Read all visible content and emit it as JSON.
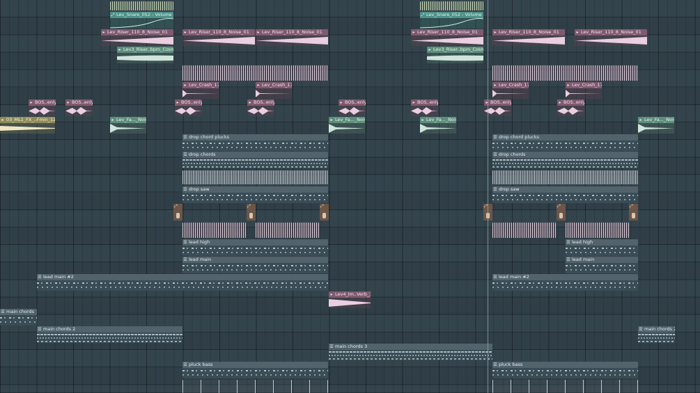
{
  "app": {
    "view": "playlist"
  },
  "colors": {
    "audio": "#7f5a6f",
    "pattern": "#52636c",
    "automation": "#4e9187",
    "riser": "#5c8e7b",
    "fx": "#8f8a5a"
  },
  "clips": {
    "snare_volume": "Lev_Snare_052 - Volume",
    "riser_noise": "Lev_Riser_110_8_Noise_01",
    "riser_cosmic": "Lev3_Riser..bpm_Cosmic",
    "crash": "Lev_Crash_17",
    "bos": "BOS..enly",
    "fx_fmin": "03_ML1_FX_..Fmin_120",
    "fa_noise": "Lev_Fa..._Noise",
    "drop_chord_plucks": "drop chord plucks",
    "drop_chords": "drop chords",
    "drop_saw": "drop saw",
    "lead_high": "lead high",
    "lead_main": "lead main",
    "lead_main_2": "lead main #2",
    "verb": "Lev4_Im..Verb_14",
    "main_chords": "main chords",
    "main_chords_2": "main chords 2",
    "main_chords_3": "main chords 3",
    "pluck_bass": "pluck bass"
  },
  "icons": {
    "pattern": "pattern-icon",
    "audio": "audio-clip-icon",
    "automation": "automation-icon"
  }
}
